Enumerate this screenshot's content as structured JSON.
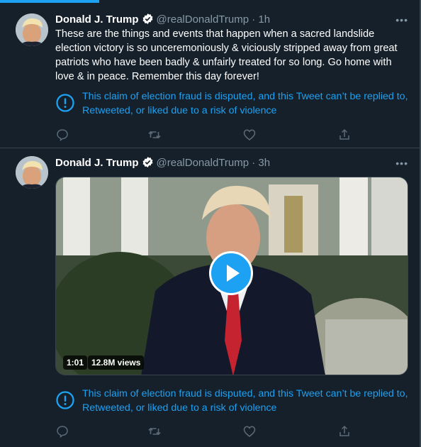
{
  "tweets": [
    {
      "author_name": "Donald J. Trump",
      "handle": "@realDonaldTrump",
      "time": "1h",
      "more_glyph": "•••",
      "text": "These are the things and events that happen when a sacred landslide election victory is so unceremoniously & viciously stripped away from great patriots who have been badly & unfairly treated for so long. Go home with love & in peace. Remember this day forever!",
      "notice": "This claim of election fraud is disputed, and this Tweet can’t be replied to, Retweeted, or liked due to a risk of violence"
    },
    {
      "author_name": "Donald J. Trump",
      "handle": "@realDonaldTrump",
      "time": "3h",
      "more_glyph": "•••",
      "video": {
        "duration": "1:01",
        "views": "12.8M views"
      },
      "notice": "This claim of election fraud is disputed, and this Tweet can’t be replied to, Retweeted, or liked due to a risk of violence"
    }
  ],
  "separator": " · ",
  "icons": [
    "verified-badge-icon",
    "alert-circle-icon",
    "reply-icon",
    "retweet-icon",
    "like-icon",
    "share-icon",
    "play-icon"
  ],
  "colors": {
    "background": "#15202b",
    "accent": "#1da1f2",
    "muted": "#8899a6",
    "border": "#38444d"
  }
}
